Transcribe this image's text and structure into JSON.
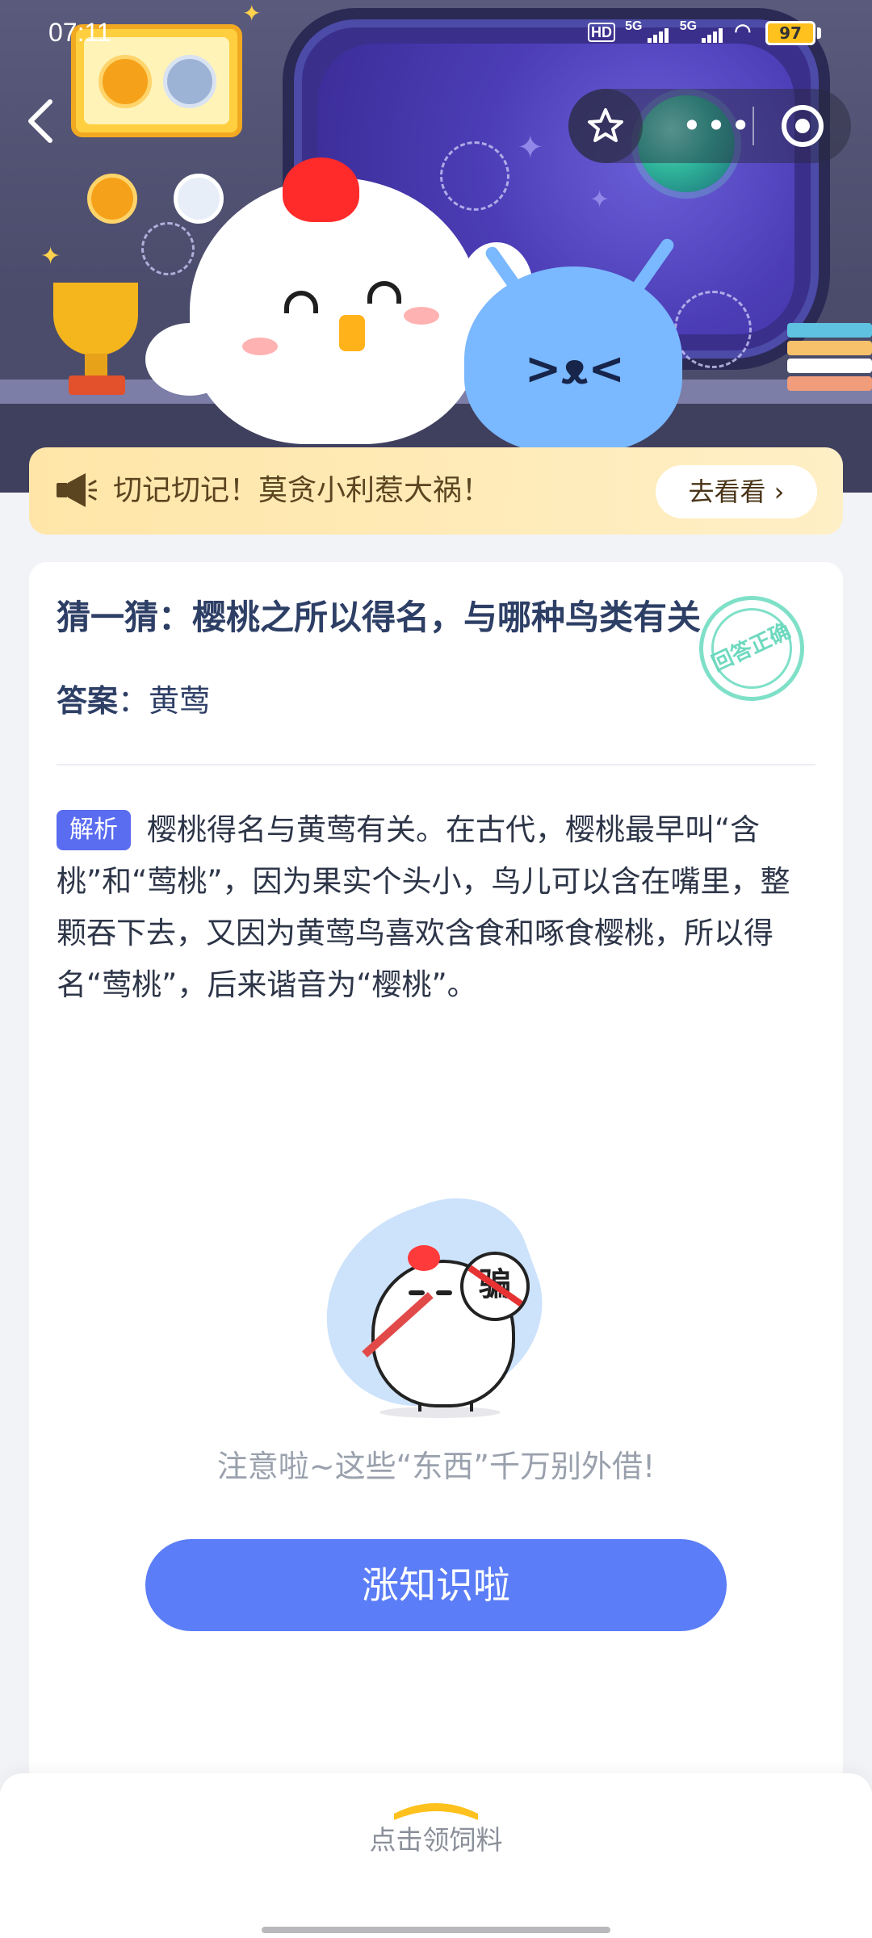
{
  "status_bar": {
    "time": "07:11",
    "hd_label": "HD",
    "net1": "5G",
    "net2": "5G",
    "battery": "97"
  },
  "nav": {
    "back_icon": "chevron-left-icon",
    "favorite_icon": "star-outline-icon",
    "more_icon": "more-dots-icon",
    "close_icon": "target-circle-icon"
  },
  "notice": {
    "icon": "megaphone-icon",
    "text": "切记切记！莫贪小利惹大祸！",
    "button": "去看看 ›"
  },
  "question": {
    "title": "猜一猜：樱桃之所以得名，与哪种鸟类有关",
    "answer_label": "答案",
    "answer_sep": "：",
    "answer_value": "黄莺",
    "stamp": "回答正确"
  },
  "analysis": {
    "tag": "解析",
    "text": "樱桃得名与黄莺有关。在古代，樱桃最早叫“含桃”和“莺桃”，因为果实个头小，鸟儿可以含在嘴里，整颗吞下去，又因为黄莺鸟喜欢含食和啄食樱桃，所以得名“莺桃”，后来谐音为“樱桃”。"
  },
  "promo": {
    "sign_char": "骗",
    "tip": "注意啦~这些“东西”千万别外借!",
    "button": "涨知识啦"
  },
  "bottom_bar": {
    "label": "点击领饲料"
  },
  "colors": {
    "accent": "#5b7df7",
    "tag": "#5a6cf0",
    "title": "#2e3f66",
    "notice_bg": "#ffe6a8",
    "stamp": "#7fe0c8"
  }
}
